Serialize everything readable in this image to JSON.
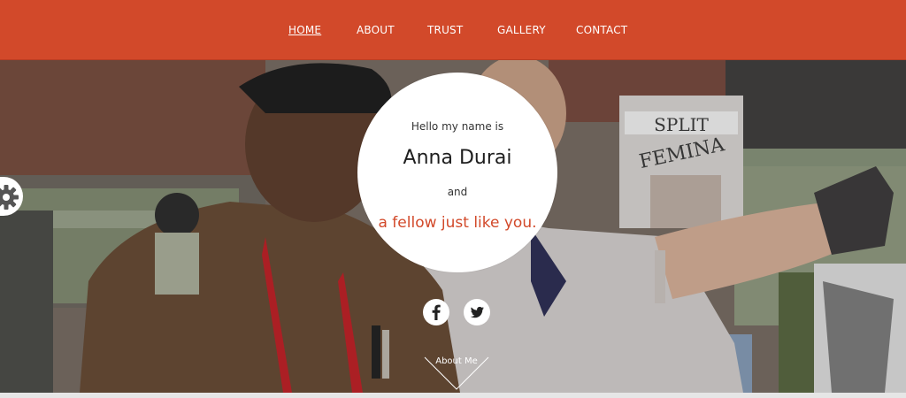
{
  "nav": {
    "items": [
      {
        "label": "HOME",
        "active": true
      },
      {
        "label": "ABOUT",
        "active": false
      },
      {
        "label": "TRUST",
        "active": false
      },
      {
        "label": "GALLERY",
        "active": false
      },
      {
        "label": "CONTACT",
        "active": false
      }
    ]
  },
  "hero": {
    "greeting": "Hello my name is",
    "name": "Anna Durai",
    "connector": "and",
    "tagline": "a fellow just like you.",
    "scroll_label": "About Me",
    "photo_text": {
      "magazine_title": "FEMINA",
      "magazine_top": "SPLIT"
    }
  },
  "social": {
    "icons": [
      "facebook-icon",
      "twitter-icon"
    ]
  },
  "colors": {
    "brand": "#d2492a",
    "white": "#ffffff",
    "text_dark": "#1e1e1e"
  }
}
